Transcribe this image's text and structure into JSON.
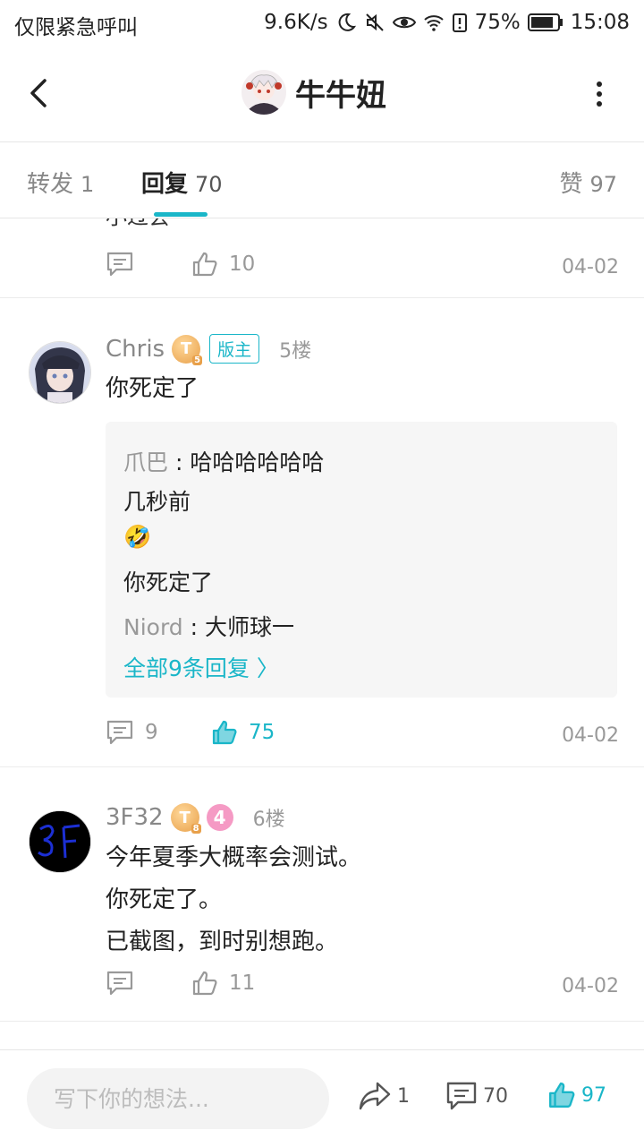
{
  "status": {
    "carrier": "仅限紧急呼叫",
    "net_speed": "9.6K/s",
    "battery": "75%",
    "time": "15:08"
  },
  "header": {
    "title": "牛牛妞"
  },
  "tabs": [
    {
      "name": "转发",
      "count": "1"
    },
    {
      "name": "回复",
      "count": "70"
    },
    {
      "name": "赞",
      "count": "97"
    }
  ],
  "prev_post": {
    "body_cut": "小过会",
    "likes": "10",
    "date": "04-02"
  },
  "posts": [
    {
      "user": "Chris",
      "level": "5",
      "role": "版主",
      "floor": "5楼",
      "body": [
        "你死定了"
      ],
      "quote": {
        "lines": [
          {
            "name": "爪巴",
            "text": " : 哈哈哈哈哈哈"
          },
          {
            "text": "几秒前"
          },
          {
            "emoji": "🤣"
          },
          {
            "text": "你死定了"
          },
          {
            "name": "Niord",
            "text": " : 大师球一"
          }
        ],
        "more": "全部9条回复 〉"
      },
      "comments": "9",
      "likes": "75",
      "date": "04-02"
    },
    {
      "user": "3F32",
      "level": "8",
      "medal": "4",
      "floor": "6楼",
      "avatar_text": "3F",
      "body": [
        "今年夏季大概率会测试。",
        "你死定了。",
        "已截图，到时别想跑。"
      ],
      "comments": "",
      "likes": "11",
      "date": "04-02"
    }
  ],
  "bottom": {
    "input_placeholder": "写下你的想法...",
    "share": "1",
    "comments": "70",
    "likes": "97"
  },
  "colors": {
    "accent": "#1ab6c8",
    "text": "#222222",
    "muted": "#999999"
  }
}
